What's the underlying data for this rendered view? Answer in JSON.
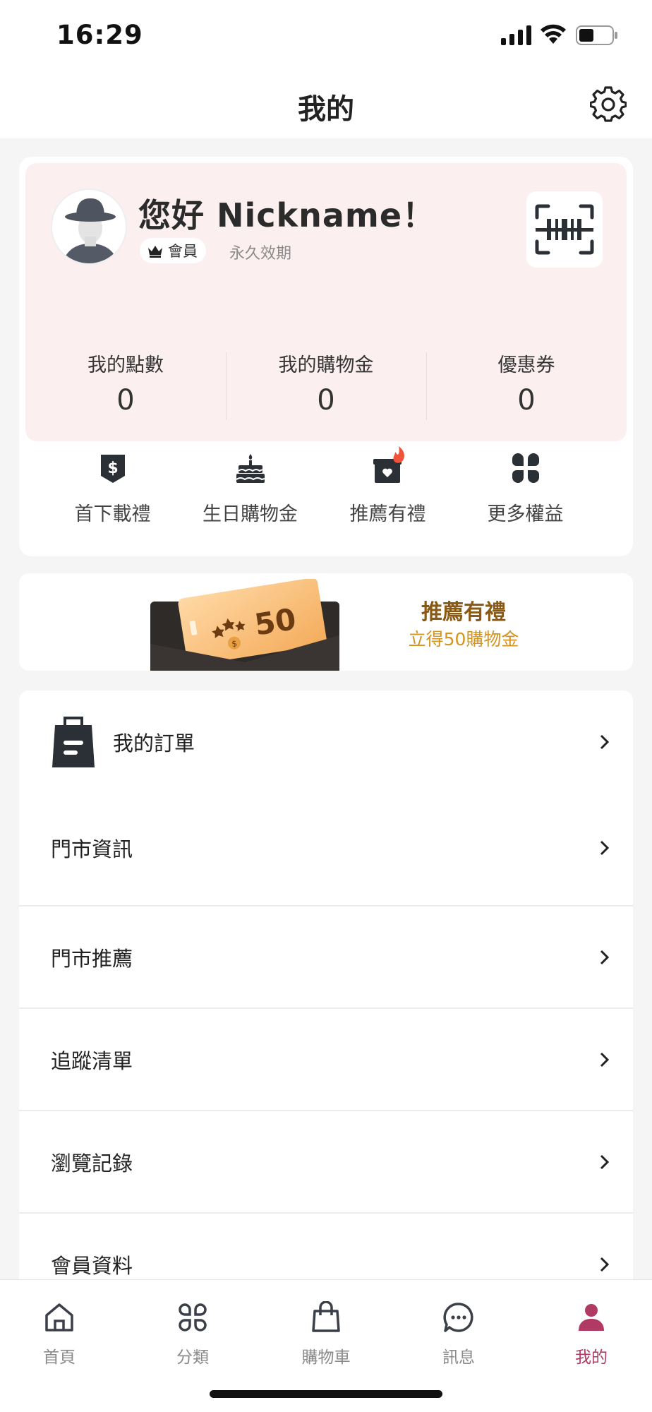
{
  "status_bar": {
    "time": "16:29"
  },
  "header": {
    "title": "我的"
  },
  "profile": {
    "greeting": "您好 Nickname！",
    "member_label": "會員",
    "validity": "永久效期",
    "stats": [
      {
        "label": "我的點數",
        "value": "0"
      },
      {
        "label": "我的購物金",
        "value": "0"
      },
      {
        "label": "優惠券",
        "value": "0"
      }
    ],
    "benefits": [
      {
        "label": "首下載禮",
        "icon": "dollar-tag-icon"
      },
      {
        "label": "生日購物金",
        "icon": "birthday-cake-icon"
      },
      {
        "label": "推薦有禮",
        "icon": "gift-box-hot-icon"
      },
      {
        "label": "更多權益",
        "icon": "more-grid-icon"
      }
    ]
  },
  "promo": {
    "badge_number": "50",
    "title": "推薦有禮",
    "subtitle": "立得50購物金"
  },
  "menu": [
    {
      "label": "我的訂單",
      "icon": "shopping-bag-icon"
    },
    {
      "label": "門市資訊"
    },
    {
      "label": "門市推薦"
    },
    {
      "label": "追蹤清單"
    },
    {
      "label": "瀏覽記錄"
    },
    {
      "label": "會員資料"
    }
  ],
  "bottom_nav": [
    {
      "label": "首頁",
      "icon": "home-icon"
    },
    {
      "label": "分類",
      "icon": "category-icon"
    },
    {
      "label": "購物車",
      "icon": "cart-bag-icon"
    },
    {
      "label": "訊息",
      "icon": "message-icon"
    },
    {
      "label": "我的",
      "icon": "person-icon",
      "active": true
    }
  ],
  "colors": {
    "accent": "#b03a63",
    "card_pink": "#fcefef",
    "promo_title": "#8a5a14",
    "promo_sub": "#d49420",
    "hot_flame": "#f0533a"
  }
}
